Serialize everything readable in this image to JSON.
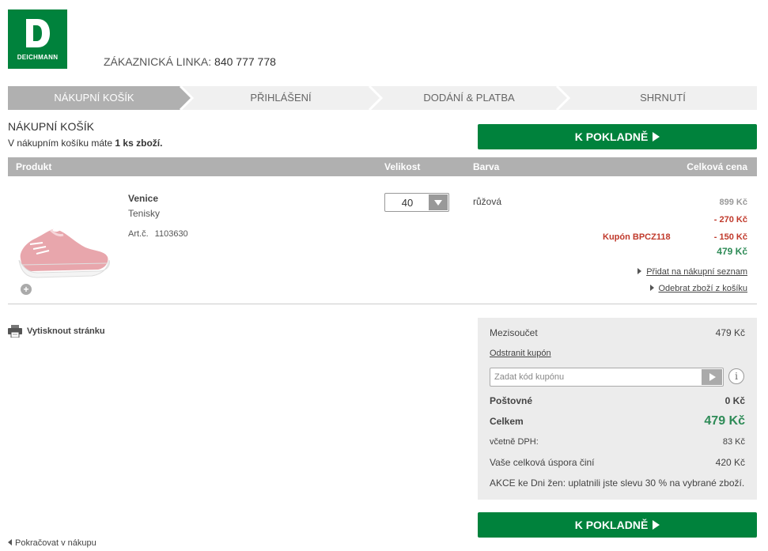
{
  "brand": {
    "name": "DEICHMANN",
    "logo_letter": "D",
    "color": "#00823c"
  },
  "hotline": {
    "label": "ZÁKAZNICKÁ LINKA:",
    "number": "840 777 778"
  },
  "steps": [
    {
      "label": "NÁKUPNÍ KOŠÍK",
      "active": true
    },
    {
      "label": "PŘIHLÁŠENÍ",
      "active": false
    },
    {
      "label": "DODÁNÍ & PLATBA",
      "active": false
    },
    {
      "label": "SHRNUTÍ",
      "active": false
    }
  ],
  "cart": {
    "title": "NÁKUPNÍ KOŠÍK",
    "subtitle_pre": "V nákupním košíku máte",
    "subtitle_count": "1 ks zboží.",
    "checkout_label": "K POKLADNĚ"
  },
  "table": {
    "col_product": "Produkt",
    "col_size": "Velikost",
    "col_color": "Barva",
    "col_total": "Celková cena"
  },
  "item": {
    "name": "Venice",
    "type": "Tenisky",
    "art_label": "Art.č.",
    "art_no": "1103630",
    "size": "40",
    "color": "růžová",
    "price_original": "899 Kč",
    "discount": "- 270 Kč",
    "coupon_label": "Kupón BPCZ118",
    "coupon_discount": "- 150 Kč",
    "price_final": "479 Kč",
    "add_to_list": "Přidat na nákupní seznam",
    "remove": "Odebrat zboží z košíku",
    "image_icon": "sneaker-image"
  },
  "print_label": "Vytisknout stránku",
  "summary": {
    "subtotal_label": "Mezisoučet",
    "subtotal": "479 Kč",
    "remove_coupon": "Odstranit kupón",
    "coupon_placeholder": "Zadat kód kupónu",
    "info_icon": "i",
    "shipping_label": "Poštovné",
    "shipping": "0 Kč",
    "total_label": "Celkem",
    "total": "479 Kč",
    "vat_label": "včetně DPH:",
    "vat": "83 Kč",
    "savings_label": "Vaše celková úspora činí",
    "savings": "420 Kč",
    "promo": "AKCE ke Dni žen: uplatnili jste slevu 30 % na vybrané zboží."
  },
  "continue_label": "Pokračovat v nákupu"
}
